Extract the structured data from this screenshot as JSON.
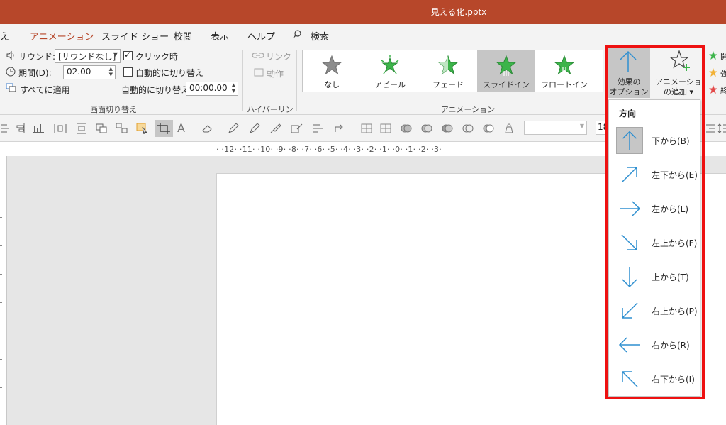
{
  "window": {
    "title": "見える化.pptx"
  },
  "tabs": [
    {
      "label": "え"
    },
    {
      "label": "アニメーション"
    },
    {
      "label": "スライド ショー"
    },
    {
      "label": "校閲"
    },
    {
      "label": "表示"
    },
    {
      "label": "ヘルプ"
    },
    {
      "label": "検索"
    }
  ],
  "transition": {
    "sound_label": "サウンド:",
    "sound_value": "[サウンドなし]",
    "on_click_label": "クリック時",
    "duration_label": "期間(D):",
    "duration_value": "02.00",
    "auto_switch_label": "自動的に切り替え",
    "apply_all_label": "すべてに適用",
    "auto_switch_time_label": "自動的に切り替え",
    "auto_switch_time_value": "00:00.00",
    "group_label": "画面切り替え"
  },
  "hyperlink": {
    "link_label": "リンク",
    "action_label": "動作",
    "group_label": "ハイパーリンク"
  },
  "animation": {
    "group_label": "アニメーション",
    "gallery": [
      {
        "label": "なし",
        "color": "#8c8c8c",
        "selected": false
      },
      {
        "label": "アピール",
        "color": "#3cb44a",
        "selected": false
      },
      {
        "label": "フェード",
        "color": "#3cb44a",
        "selected": false
      },
      {
        "label": "スライドイン",
        "color": "#3cb44a",
        "selected": true
      },
      {
        "label": "フロートイン",
        "color": "#3cb44a",
        "selected": false
      }
    ],
    "effect_options_label_1": "効果の",
    "effect_options_label_2": "オプション",
    "add_animation_label_1": "アニメーション",
    "add_animation_label_2": "の追加"
  },
  "side_labels": [
    "開",
    "強",
    "終"
  ],
  "toolbar2": {
    "font_size_value": "18"
  },
  "ruler": {
    "text": "·  ·12·  ·11·  ·10·  ·9·  ·8·  ·7·  ·6·  ·5·  ·4·  ·3·  ·2·  ·1·  ·0·  ·1·  ·2·  ·3·"
  },
  "direction_menu": {
    "header": "方向",
    "items": [
      {
        "label": "下から(B)",
        "selected": true
      },
      {
        "label": "左下から(E)",
        "selected": false
      },
      {
        "label": "左から(L)",
        "selected": false
      },
      {
        "label": "左上から(F)",
        "selected": false
      },
      {
        "label": "上から(T)",
        "selected": false
      },
      {
        "label": "右上から(P)",
        "selected": false
      },
      {
        "label": "右から(R)",
        "selected": false
      },
      {
        "label": "右下から(I)",
        "selected": false
      }
    ]
  },
  "colors": {
    "title_bar": "#b7472a",
    "highlight": "#ee1111",
    "arrow": "#2e8fd0",
    "star_green": "#3cb44a"
  }
}
